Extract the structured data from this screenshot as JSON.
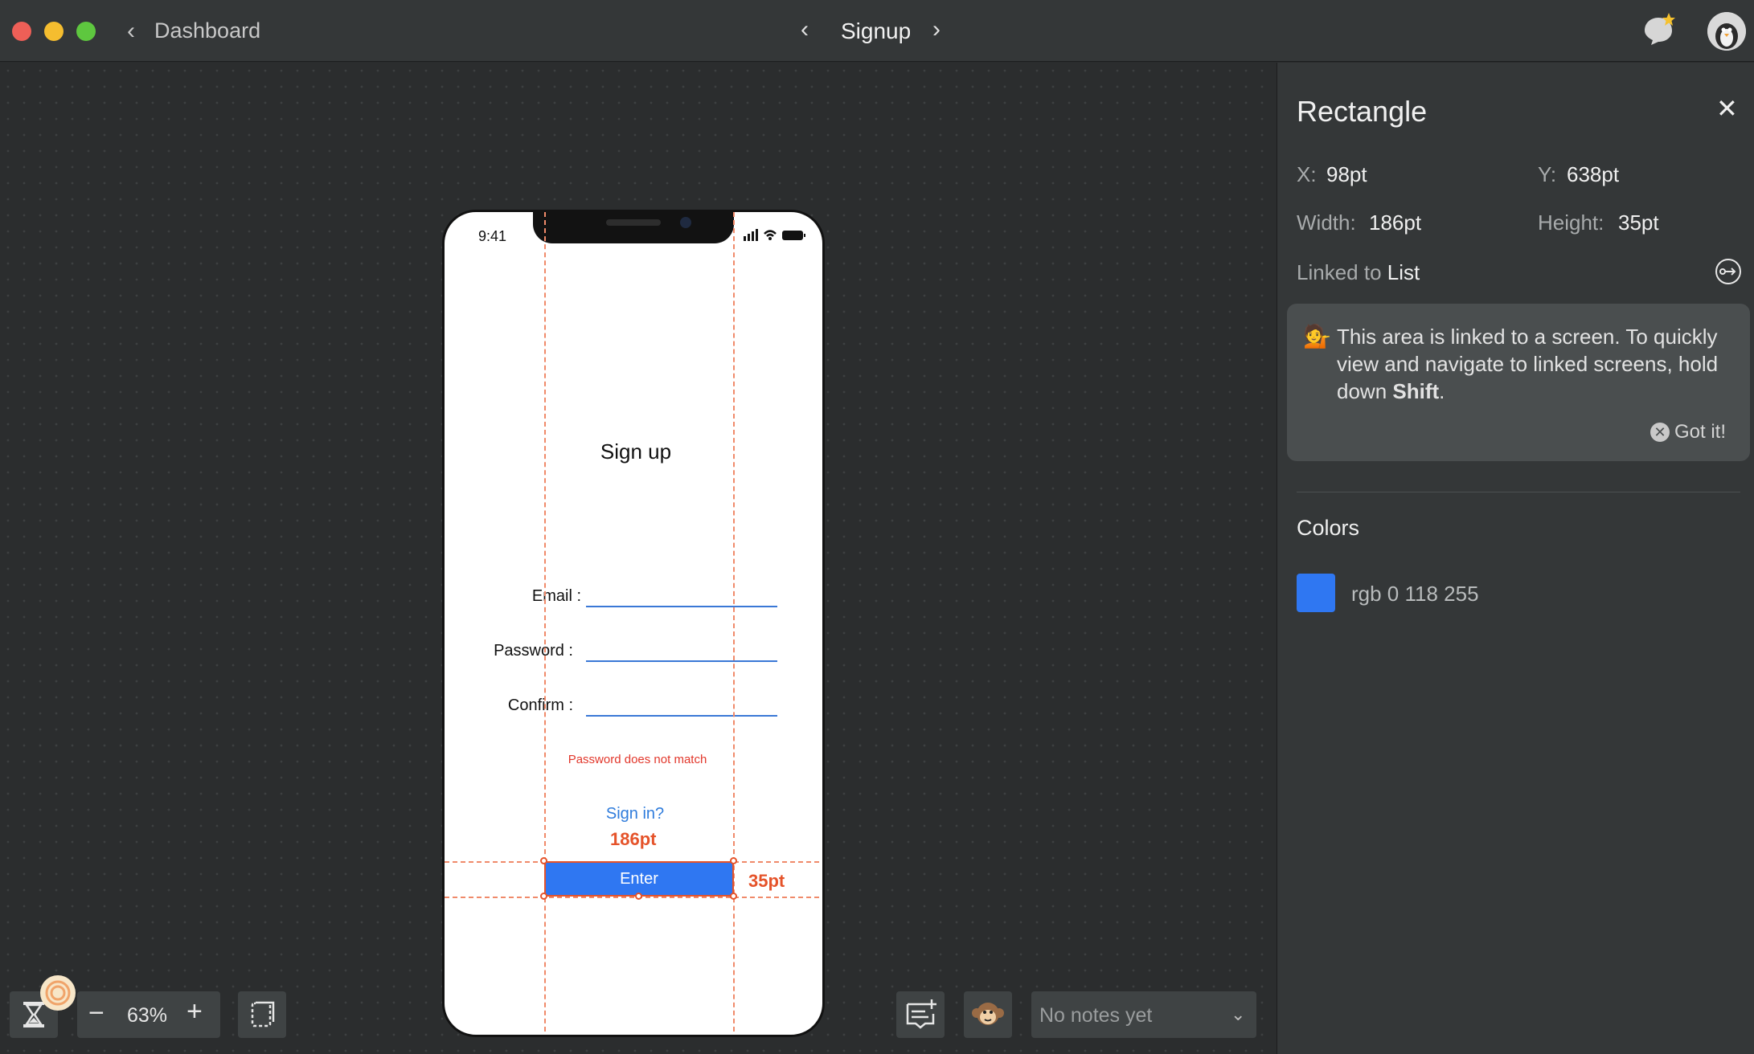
{
  "window": {
    "back_label": "Dashboard",
    "screen_title": "Signup"
  },
  "phone": {
    "status_time": "9:41",
    "title": "Sign up",
    "fields": [
      {
        "label": "Email :"
      },
      {
        "label": "Password :"
      },
      {
        "label": "Confirm :"
      }
    ],
    "error_text": "Password does not match",
    "signin_link": "Sign in?",
    "enter_button": "Enter",
    "measure_width": "186pt",
    "measure_height": "35pt"
  },
  "toolbar": {
    "zoom": "63%",
    "notes_placeholder": "No notes yet"
  },
  "inspector": {
    "title": "Rectangle",
    "x_label": "X:",
    "x_value": "98pt",
    "y_label": "Y:",
    "y_value": "638pt",
    "width_label": "Width:",
    "width_value": "186pt",
    "height_label": "Height:",
    "height_value": "35pt",
    "linked_prefix": "Linked to",
    "linked_target": "List",
    "hint": {
      "emoji": "💁",
      "text_before": "This area is linked to a screen. To quickly view and navigate to linked screens, hold down",
      "key": "Shift",
      "text_after": ".",
      "dismiss": "Got it!"
    },
    "colors_title": "Colors",
    "colors": [
      {
        "label": "rgb 0 118 255",
        "hex": "#2f77f2"
      }
    ]
  },
  "icons": {
    "back": "chevron-left-icon",
    "prev": "chevron-left-icon",
    "next": "chevron-right-icon",
    "tips": "tips-bubble-icon",
    "avatar": "penguin-avatar",
    "close": "close-icon",
    "linked": "link-arrow-icon",
    "hourglass": "hourglass-icon",
    "select_area": "select-area-icon",
    "add_note": "add-note-icon",
    "monkey": "monkey-icon",
    "dropdown": "chevron-down-icon"
  }
}
